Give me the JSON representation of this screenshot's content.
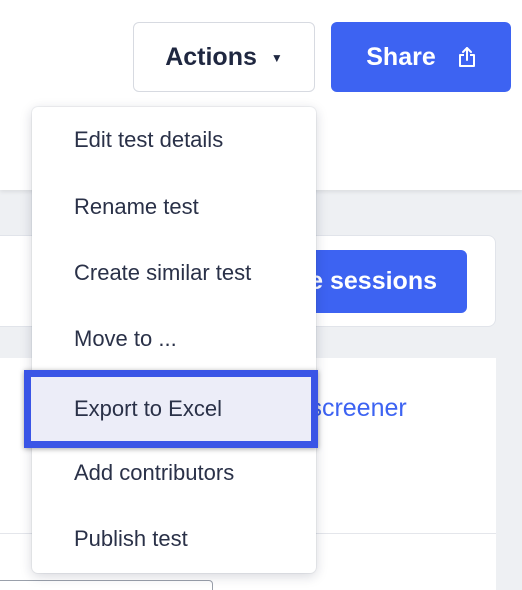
{
  "toolbar": {
    "actions_label": "Actions",
    "share_label": "Share"
  },
  "background": {
    "sessions_button_label": "e sessions",
    "screener_link": "it screener"
  },
  "menu": {
    "items": [
      {
        "label": "Edit test details"
      },
      {
        "label": "Rename test"
      },
      {
        "label": "Create similar test"
      },
      {
        "label": "Move to ..."
      },
      {
        "label": "Export to Excel",
        "highlighted": true
      },
      {
        "label": "Add contributors"
      },
      {
        "label": "Publish test"
      }
    ]
  },
  "colors": {
    "accent": "#3d63f2",
    "highlight_border": "#3a55e6",
    "highlight_fill": "#ecedf8"
  },
  "icons": {
    "actions_caret": "caret-down-icon",
    "share": "share-upload-icon"
  }
}
